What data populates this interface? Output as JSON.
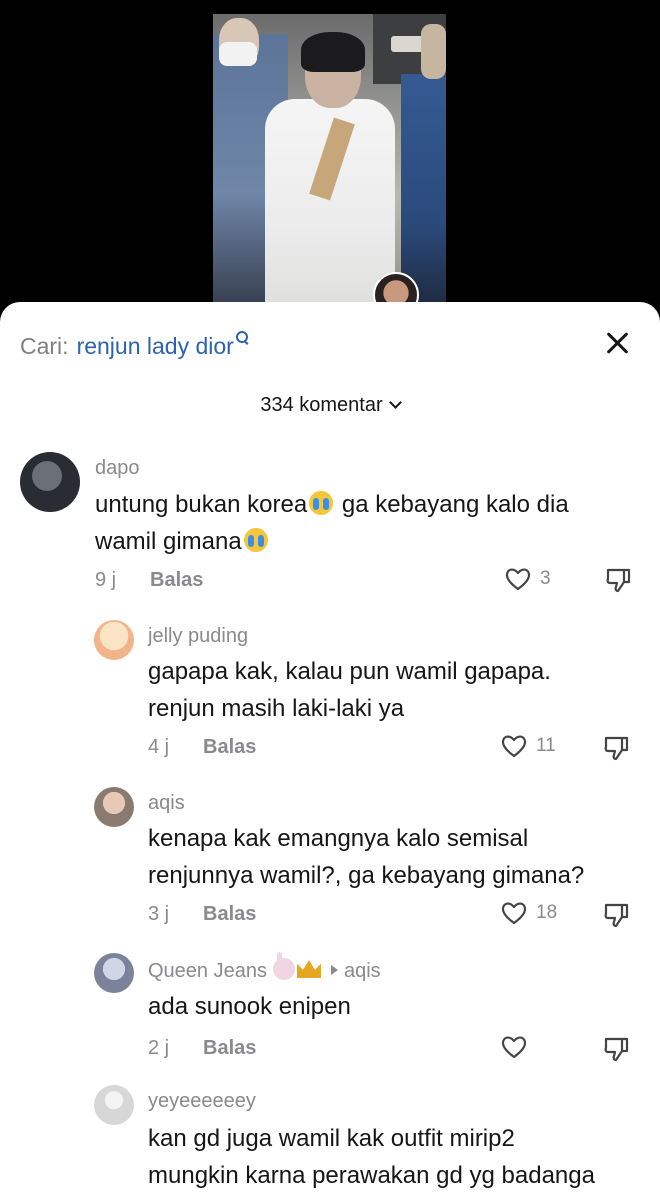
{
  "search": {
    "prefix": "Cari:",
    "term": "renjun lady dior"
  },
  "comments_header": {
    "count_label": "334 komentar"
  },
  "comments": [
    {
      "user": "dapo",
      "text_a": "untung bukan korea",
      "text_b": " ga kebayang kalo dia",
      "text_c": "wamil gimana",
      "time": "9 j",
      "reply_label": "Balas",
      "likes": "3"
    },
    {
      "user": "jelly puding",
      "text_line1": "gapapa kak, kalau pun wamil gapapa.",
      "text_line2": "renjun masih laki-laki ya",
      "time": "4 j",
      "reply_label": "Balas",
      "likes": "11"
    },
    {
      "user": "aqis",
      "text_line1": "kenapa kak emangnya kalo semisal",
      "text_line2": "renjunnya wamil?, ga kebayang gimana?",
      "time": "3 j",
      "reply_label": "Balas",
      "likes": "18"
    },
    {
      "user": "Queen Jeans",
      "reply_to": "aqis",
      "text_line1": "ada sunook enipen",
      "time": "2 j",
      "reply_label": "Balas",
      "likes": ""
    },
    {
      "user": "yeyeeeeeey",
      "text_line1": "kan gd juga wamil kak outfit mirip2",
      "text_line2": "mungkin karna perawakan gd yg badanga"
    }
  ]
}
